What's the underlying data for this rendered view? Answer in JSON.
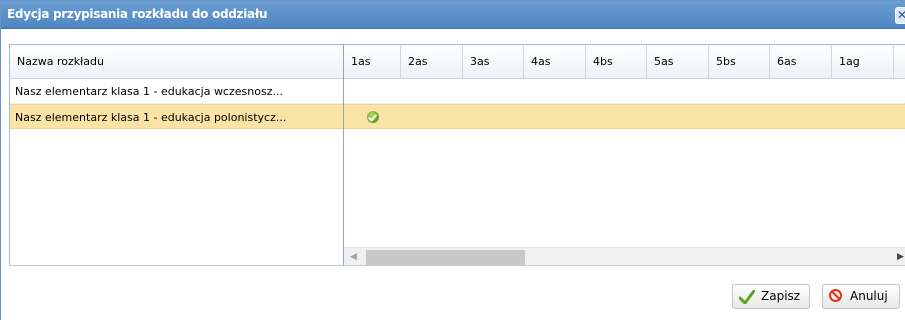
{
  "dialog": {
    "title": "Edycja przypisania rozkładu do oddziału",
    "close_glyph": "✕"
  },
  "grid": {
    "first_column_header": "Nazwa rozkładu",
    "columns": [
      "1as",
      "2as",
      "3as",
      "4as",
      "4bs",
      "5as",
      "5bs",
      "6as",
      "1ag"
    ],
    "rows": [
      {
        "name": "Nasz elementarz klasa 1 - edukacja wczesnosz...",
        "selected": false,
        "checked_column": null
      },
      {
        "name": "Nasz elementarz klasa 1 - edukacja polonistycz...",
        "selected": true,
        "checked_column": "1as"
      }
    ]
  },
  "icons": {
    "close": "close-icon",
    "check": "check-circle-icon",
    "scroll_left": "scroll-left-arrow-icon",
    "scroll_right": "scroll-right-arrow-icon",
    "save": "checkmark-icon",
    "cancel": "no-entry-icon"
  },
  "buttons": {
    "save_label": "Zapisz",
    "cancel_label": "Anuluj"
  },
  "colors": {
    "title_bar": "#5a8fc8",
    "selected_row": "#fbe3a6",
    "check_icon": "#6aa823",
    "cancel_icon": "#e0321e"
  }
}
